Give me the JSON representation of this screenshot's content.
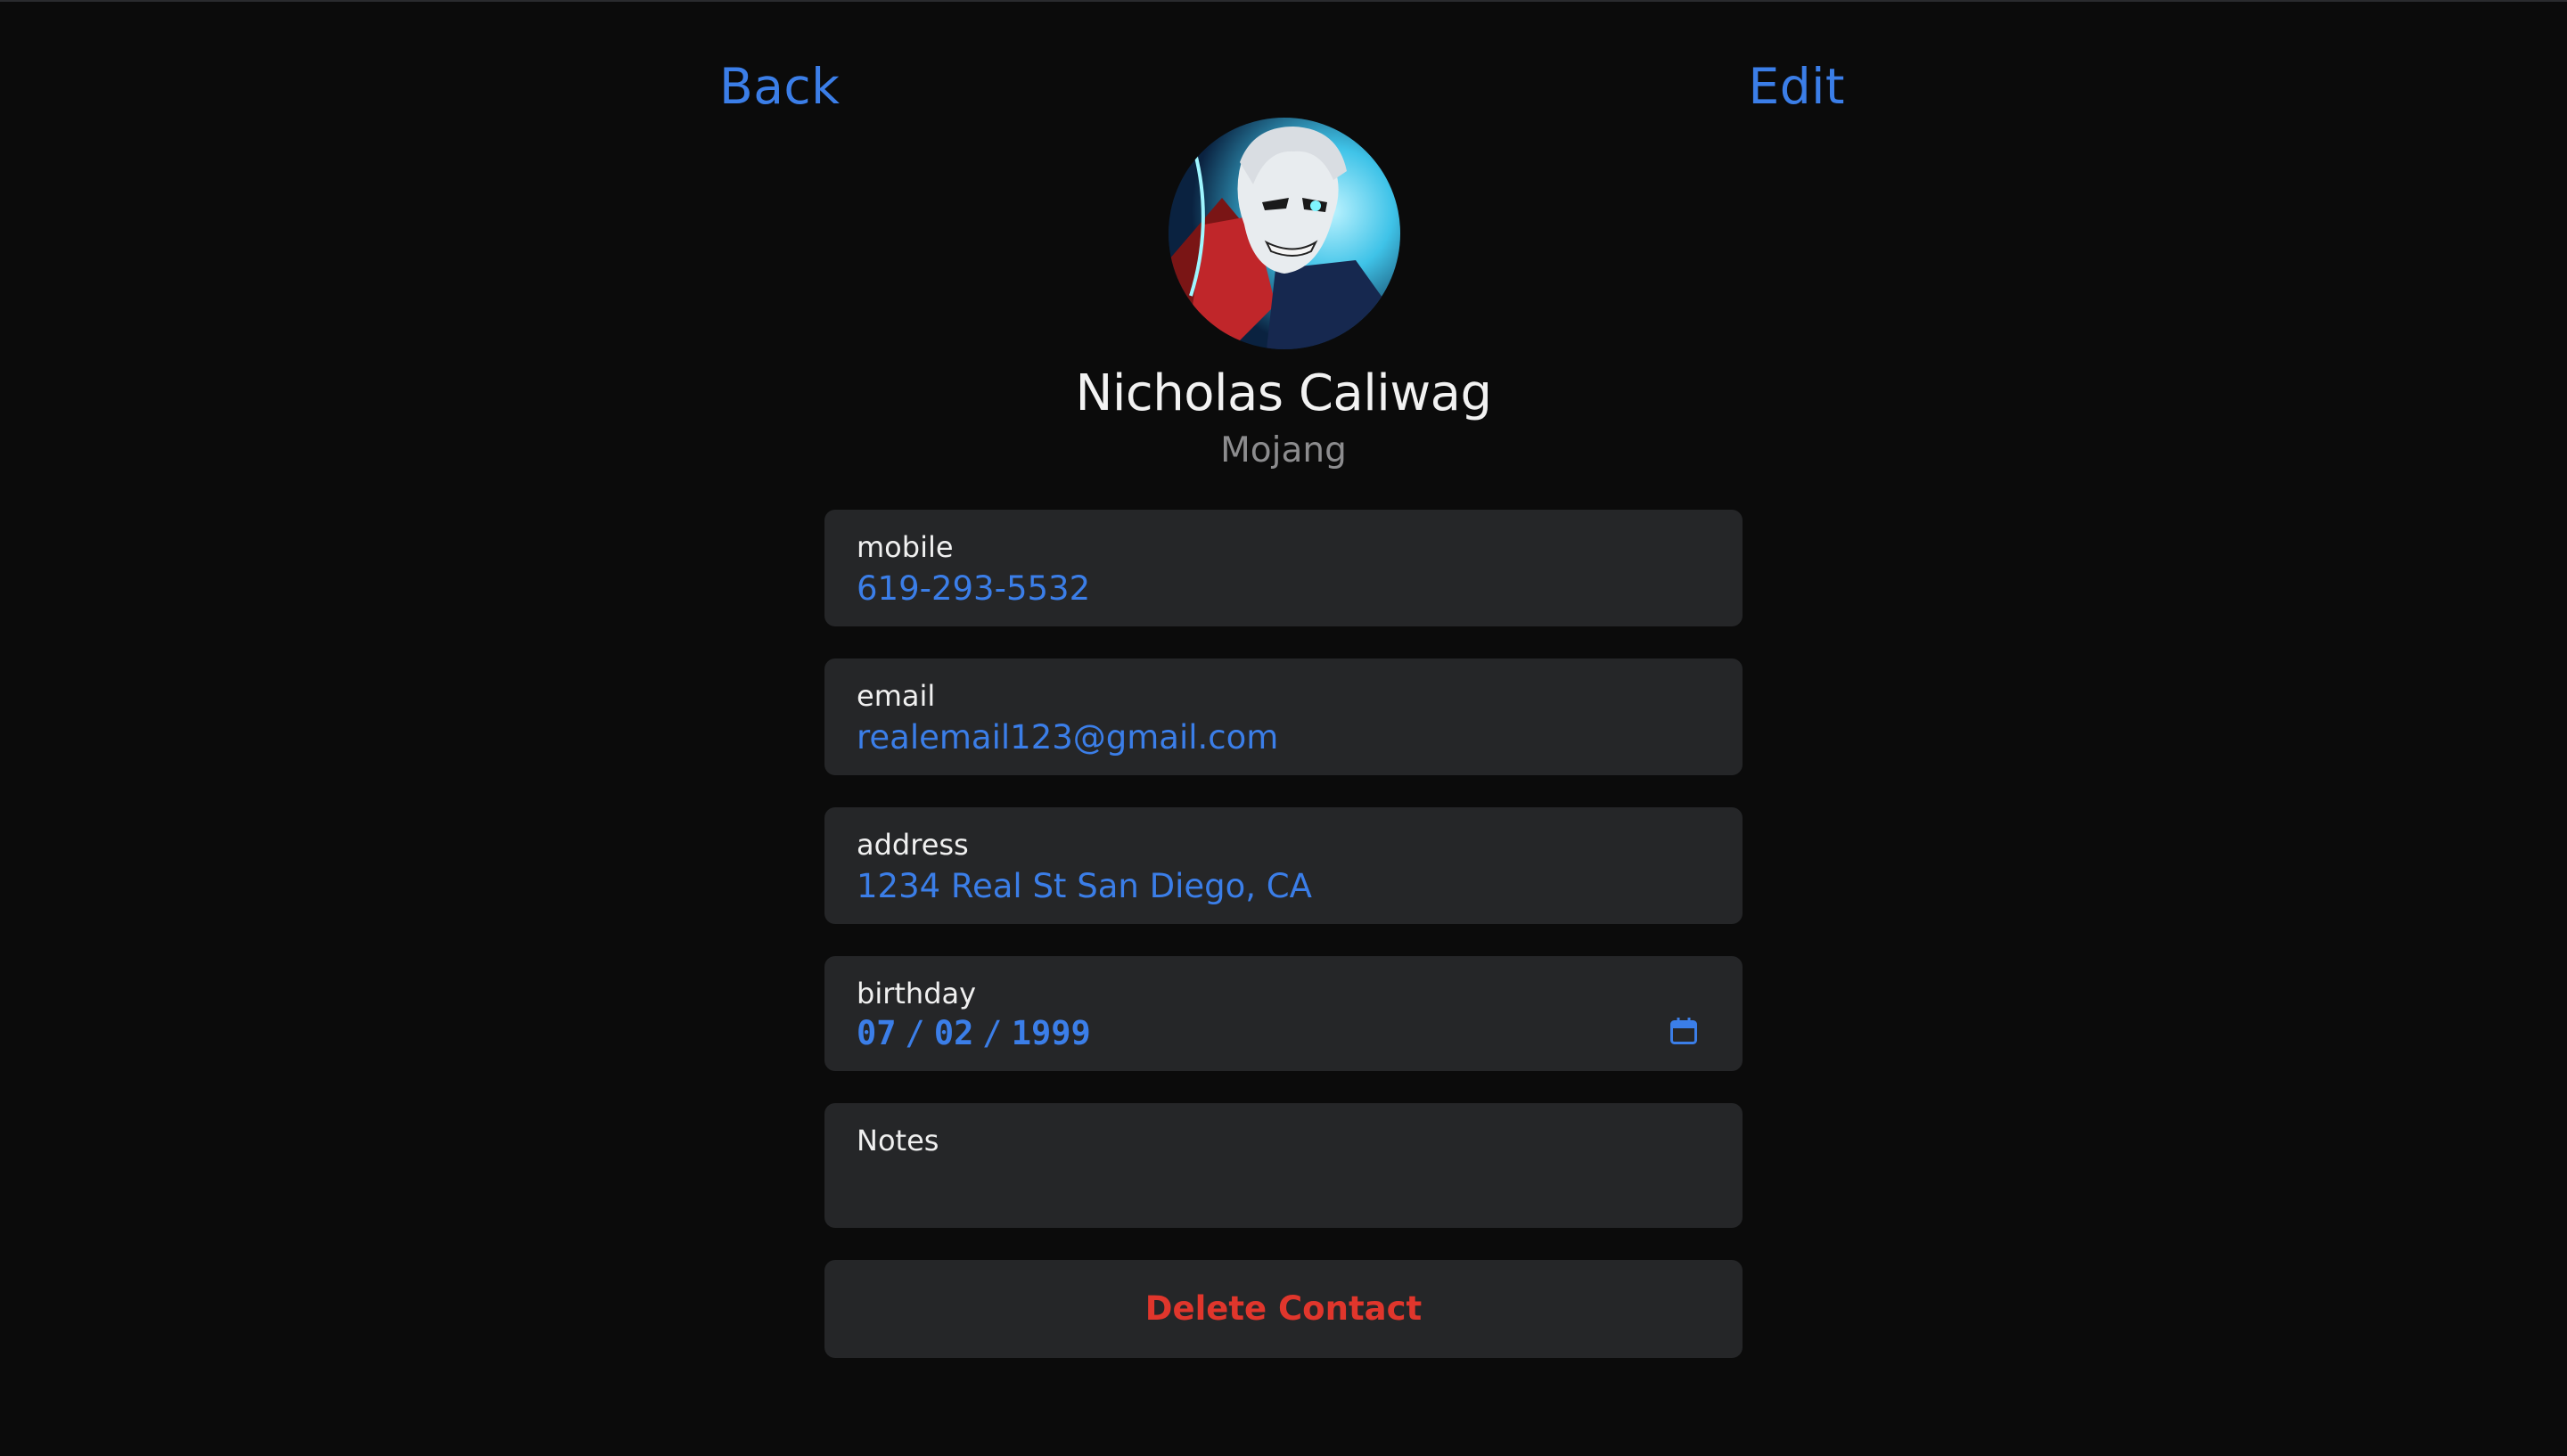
{
  "nav": {
    "back_label": "Back",
    "edit_label": "Edit"
  },
  "contact": {
    "name": "Nicholas Caliwag",
    "company": "Mojang",
    "avatar_icon": "avatar-photo-icon"
  },
  "fields": {
    "mobile": {
      "label": "mobile",
      "value": "619-293-5532"
    },
    "email": {
      "label": "email",
      "value": "realemail123@gmail.com"
    },
    "address": {
      "label": "address",
      "value": "1234 Real St San Diego, CA"
    },
    "birthday": {
      "label": "birthday",
      "month": "07",
      "day": "02",
      "year": "1999",
      "separator": "/",
      "icon": "calendar-icon"
    },
    "notes": {
      "label": "Notes",
      "value": ""
    }
  },
  "actions": {
    "delete_label": "Delete Contact"
  },
  "colors": {
    "background": "#0b0b0b",
    "card": "#252628",
    "accent": "#3b7ee8",
    "danger": "#e0362c",
    "secondary_text": "#8c8c8e"
  }
}
